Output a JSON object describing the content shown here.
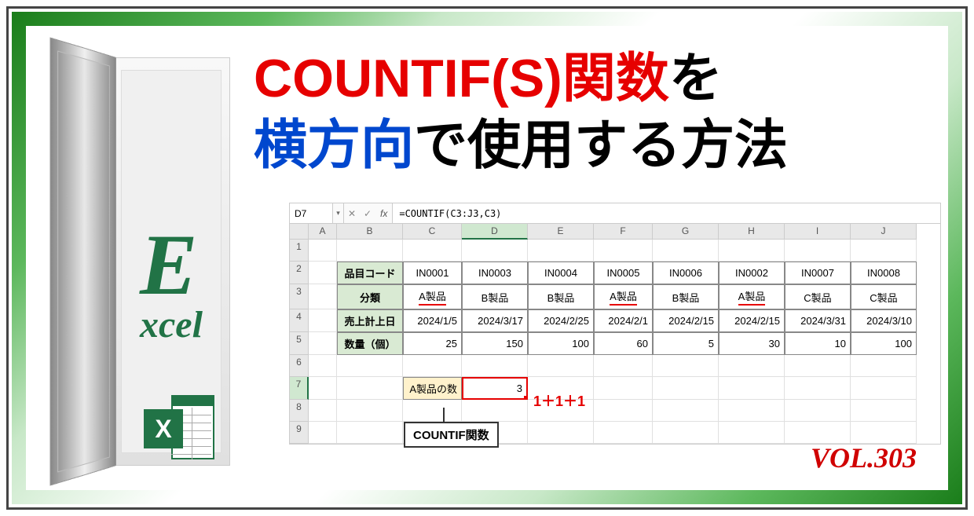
{
  "brand": {
    "letter_e": "E",
    "rest": "xcel",
    "icon_letter": "X"
  },
  "title": {
    "part1_red": "COUNTIF(S)関数",
    "part1_black": "を",
    "part2_blue": "横方向",
    "part2_black": "で使用する方法"
  },
  "formula_bar": {
    "name_box": "D7",
    "fx": "fx",
    "formula": "=COUNTIF(C3:J3,C3)"
  },
  "columns": [
    "A",
    "B",
    "C",
    "D",
    "E",
    "F",
    "G",
    "H",
    "I",
    "J"
  ],
  "rows": [
    "1",
    "2",
    "3",
    "4",
    "5",
    "6",
    "7",
    "8",
    "9"
  ],
  "headers_v": [
    "品目コード",
    "分類",
    "売上計上日",
    "数量（個）"
  ],
  "chart_data": {
    "type": "table",
    "columns": [
      "品目コード",
      "分類",
      "売上計上日",
      "数量（個）"
    ],
    "records": [
      {
        "品目コード": "IN0001",
        "分類": "A製品",
        "売上計上日": "2024/1/5",
        "数量（個）": 25
      },
      {
        "品目コード": "IN0003",
        "分類": "B製品",
        "売上計上日": "2024/3/17",
        "数量（個）": 150
      },
      {
        "品目コード": "IN0004",
        "分類": "B製品",
        "売上計上日": "2024/2/25",
        "数量（個）": 100
      },
      {
        "品目コード": "IN0005",
        "分類": "A製品",
        "売上計上日": "2024/2/1",
        "数量（個）": 60
      },
      {
        "品目コード": "IN0006",
        "分類": "B製品",
        "売上計上日": "2024/2/15",
        "数量（個）": 5
      },
      {
        "品目コード": "IN0002",
        "分類": "A製品",
        "売上計上日": "2024/2/15",
        "数量（個）": 30
      },
      {
        "品目コード": "IN0007",
        "分類": "C製品",
        "売上計上日": "2024/3/31",
        "数量（個）": 10
      },
      {
        "品目コード": "IN0008",
        "分類": "C製品",
        "売上計上日": "2024/3/10",
        "数量（個）": 100
      }
    ]
  },
  "data": {
    "product_codes": [
      "IN0001",
      "IN0003",
      "IN0004",
      "IN0005",
      "IN0006",
      "IN0002",
      "IN0007",
      "IN0008"
    ],
    "categories": [
      "A製品",
      "B製品",
      "B製品",
      "A製品",
      "B製品",
      "A製品",
      "C製品",
      "C製品"
    ],
    "dates": [
      "2024/1/5",
      "2024/3/17",
      "2024/2/25",
      "2024/2/1",
      "2024/2/15",
      "2024/2/15",
      "2024/3/31",
      "2024/3/10"
    ],
    "quantities": [
      "25",
      "150",
      "100",
      "60",
      "5",
      "30",
      "10",
      "100"
    ],
    "highlighted": [
      true,
      false,
      false,
      true,
      false,
      true,
      false,
      false
    ]
  },
  "result": {
    "label": "A製品の数",
    "value": "3",
    "annotation": "1＋1＋1",
    "callout": "COUNTIF関数"
  },
  "volume": "VOL.303"
}
